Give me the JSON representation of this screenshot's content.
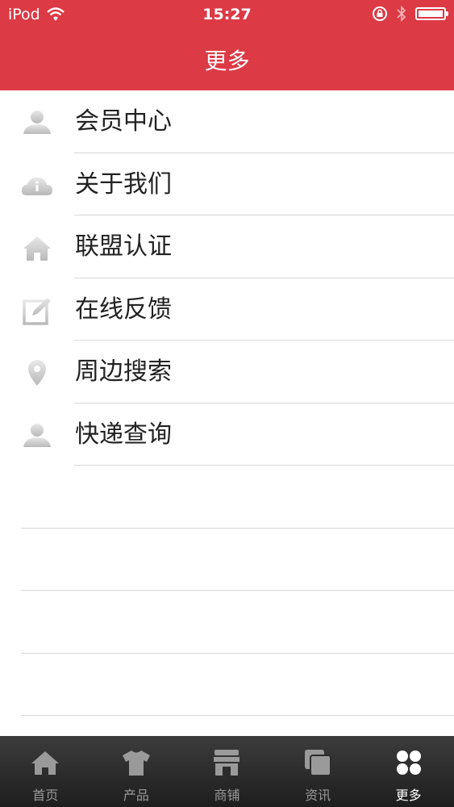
{
  "status_bar": {
    "carrier": "iPod",
    "time": "15:27"
  },
  "header": {
    "title": "更多"
  },
  "menu": {
    "items": [
      {
        "label": "会员中心",
        "icon": "person-icon"
      },
      {
        "label": "关于我们",
        "icon": "cloud-info-icon"
      },
      {
        "label": "联盟认证",
        "icon": "home-icon"
      },
      {
        "label": "在线反馈",
        "icon": "edit-icon"
      },
      {
        "label": "周边搜索",
        "icon": "location-pin-icon"
      },
      {
        "label": "快递查询",
        "icon": "person-icon"
      }
    ]
  },
  "tabbar": {
    "tabs": [
      {
        "label": "首页",
        "icon": "home-icon"
      },
      {
        "label": "产品",
        "icon": "tshirt-icon"
      },
      {
        "label": "商铺",
        "icon": "store-icon"
      },
      {
        "label": "资讯",
        "icon": "news-icon"
      },
      {
        "label": "更多",
        "icon": "grid-icon",
        "active": true
      }
    ]
  },
  "colors": {
    "header_bg": "#dc3a45",
    "tab_active": "#ffffff",
    "tab_inactive": "#9a9a9a"
  }
}
